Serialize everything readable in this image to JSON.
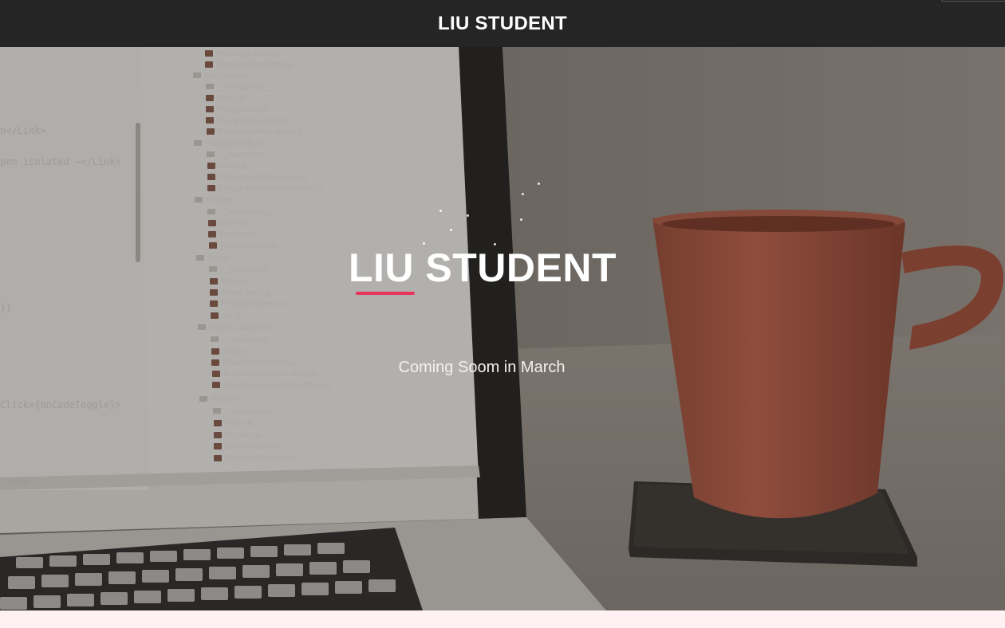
{
  "navbar": {
    "brand": "LIU STUDENT"
  },
  "hero": {
    "title": "LIU STUDENT",
    "subtitle": "Coming Soom in March",
    "accent_color": "#e8345a"
  },
  "background": {
    "code_lines": [
      "n</Link>",
      "pen isolated →</Link>",
      "})",
      "Click={onCodeToggle}>"
    ],
    "file_tree": [
      {
        "label": "Message.spec.js",
        "kind": "file"
      },
      {
        "label": "MessageRenderer.js",
        "kind": "file"
      },
      {
        "label": "Playground",
        "kind": "dir"
      },
      {
        "label": "__snapshots__",
        "kind": "dir"
      },
      {
        "label": "index.js",
        "kind": "file"
      },
      {
        "label": "Playground.js",
        "kind": "file"
      },
      {
        "label": "Playground.spec.js",
        "kind": "file"
      },
      {
        "label": "PlaygroundRenderer.js",
        "kind": "file"
      },
      {
        "label": "PlaygroundError",
        "kind": "dir"
      },
      {
        "label": "__snapshots__",
        "kind": "dir"
      },
      {
        "label": "index.js",
        "kind": "file"
      },
      {
        "label": "PlaygroundError.spec.js",
        "kind": "file"
      },
      {
        "label": "PlaygroundErrorRenderer.js",
        "kind": "file"
      },
      {
        "label": "Preview",
        "kind": "dir"
      },
      {
        "label": "__snapshots__",
        "kind": "dir"
      },
      {
        "label": "index.js",
        "kind": "file"
      },
      {
        "label": "Preview.js",
        "kind": "file"
      },
      {
        "label": "Preview.spec.js",
        "kind": "file"
      },
      {
        "label": "Props",
        "kind": "dir"
      },
      {
        "label": "__snapshots__",
        "kind": "dir"
      },
      {
        "label": "index.js",
        "kind": "file"
      },
      {
        "label": "Props.spec.js",
        "kind": "file"
      },
      {
        "label": "PropsRenderer.js",
        "kind": "file"
      },
      {
        "label": "util.js",
        "kind": "file"
      },
      {
        "label": "ReactComponent",
        "kind": "dir"
      },
      {
        "label": "__snapshots__",
        "kind": "dir"
      },
      {
        "label": "index.js",
        "kind": "file"
      },
      {
        "label": "ReactComponent.js",
        "kind": "file"
      },
      {
        "label": "ReactComponent.spec.js",
        "kind": "file"
      },
      {
        "label": "ReactComponentRenderer.js",
        "kind": "file"
      },
      {
        "label": "Section",
        "kind": "dir"
      },
      {
        "label": "__snapshots__",
        "kind": "dir"
      },
      {
        "label": "index.js",
        "kind": "file"
      },
      {
        "label": "Section.js",
        "kind": "file"
      },
      {
        "label": "Section.spec.js",
        "kind": "file"
      },
      {
        "label": "SectionRenderer.js",
        "kind": "file"
      }
    ],
    "status_bar": "65:13   LF:   UTF-8:   Git: next",
    "status_left": ", 19:03)"
  }
}
